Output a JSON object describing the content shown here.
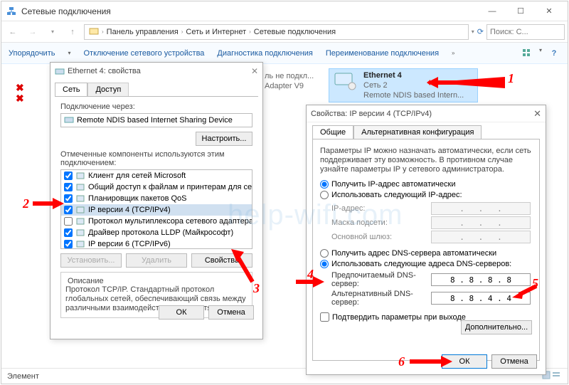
{
  "window": {
    "title": "Сетевые подключения",
    "search_placeholder": "Поиск: С..."
  },
  "breadcrumb": {
    "p1": "Панель управления",
    "p2": "Сеть и Интернет",
    "p3": "Сетевые подключения"
  },
  "toolbar": {
    "organize": "Упорядочить",
    "disable": "Отключение сетевого устройства",
    "diag": "Диагностика подключения",
    "rename": "Переименование подключения"
  },
  "net_items": {
    "left1": {
      "l1": "",
      "l2": "ль не подкл...",
      "l3": "Adapter V9"
    },
    "eth4": {
      "l1": "Ethernet 4",
      "l2": "Сеть 2",
      "l3": "Remote NDIS based Intern..."
    }
  },
  "statusbar": {
    "text": "Элемент"
  },
  "dlg1": {
    "title": "Ethernet 4: свойства",
    "tab_net": "Сеть",
    "tab_access": "Доступ",
    "connect_via": "Подключение через:",
    "device": "Remote NDIS based Internet Sharing Device",
    "configure": "Настроить...",
    "components_label": "Отмеченные компоненты используются этим подключением:",
    "components": [
      {
        "checked": true,
        "label": "Клиент для сетей Microsoft"
      },
      {
        "checked": true,
        "label": "Общий доступ к файлам и принтерам для сетей Mi"
      },
      {
        "checked": true,
        "label": "Планировщик пакетов QoS"
      },
      {
        "checked": true,
        "label": "IP версии 4 (TCP/IPv4)"
      },
      {
        "checked": false,
        "label": "Протокол мультиплексора сетевого адаптера (Ма"
      },
      {
        "checked": true,
        "label": "Драйвер протокола LLDP (Майкрософт)"
      },
      {
        "checked": true,
        "label": "IP версии 6 (TCP/IPv6)"
      }
    ],
    "install": "Установить...",
    "uninstall": "Удалить",
    "props": "Свойства",
    "desc_title": "Описание",
    "desc_text": "Протокол TCP/IP. Стандартный протокол глобальных сетей, обеспечивающий связь между различными взаимодействующими сетями.",
    "ok": "ОК",
    "cancel": "Отмена"
  },
  "dlg2": {
    "title": "Свойства: IP версии 4 (TCP/IPv4)",
    "tab1": "Общие",
    "tab2": "Альтернативная конфигурация",
    "intro": "Параметры IP можно назначать автоматически, если сеть поддерживает эту возможность. В противном случае узнайте параметры IP у сетевого администратора.",
    "r_ip_auto": "Получить IP-адрес автоматически",
    "r_ip_manual": "Использовать следующий IP-адрес:",
    "ip_addr": "IP-адрес:",
    "subnet": "Маска подсети:",
    "gateway": "Основной шлюз:",
    "r_dns_auto": "Получить адрес DNS-сервера автоматически",
    "r_dns_manual": "Использовать следующие адреса DNS-серверов:",
    "dns_pref": "Предпочитаемый DNS-сервер:",
    "dns_alt": "Альтернативный DNS-сервер:",
    "dns_pref_val": "8 . 8 . 8 . 8",
    "dns_alt_val": "8 . 8 . 4 . 4",
    "confirm": "Подтвердить параметры при выходе",
    "advanced": "Дополнительно...",
    "ok": "ОК",
    "cancel": "Отмена"
  },
  "markers": {
    "n1": "1",
    "n2": "2",
    "n3": "3",
    "n4": "4",
    "n5": "5",
    "n6": "6"
  }
}
